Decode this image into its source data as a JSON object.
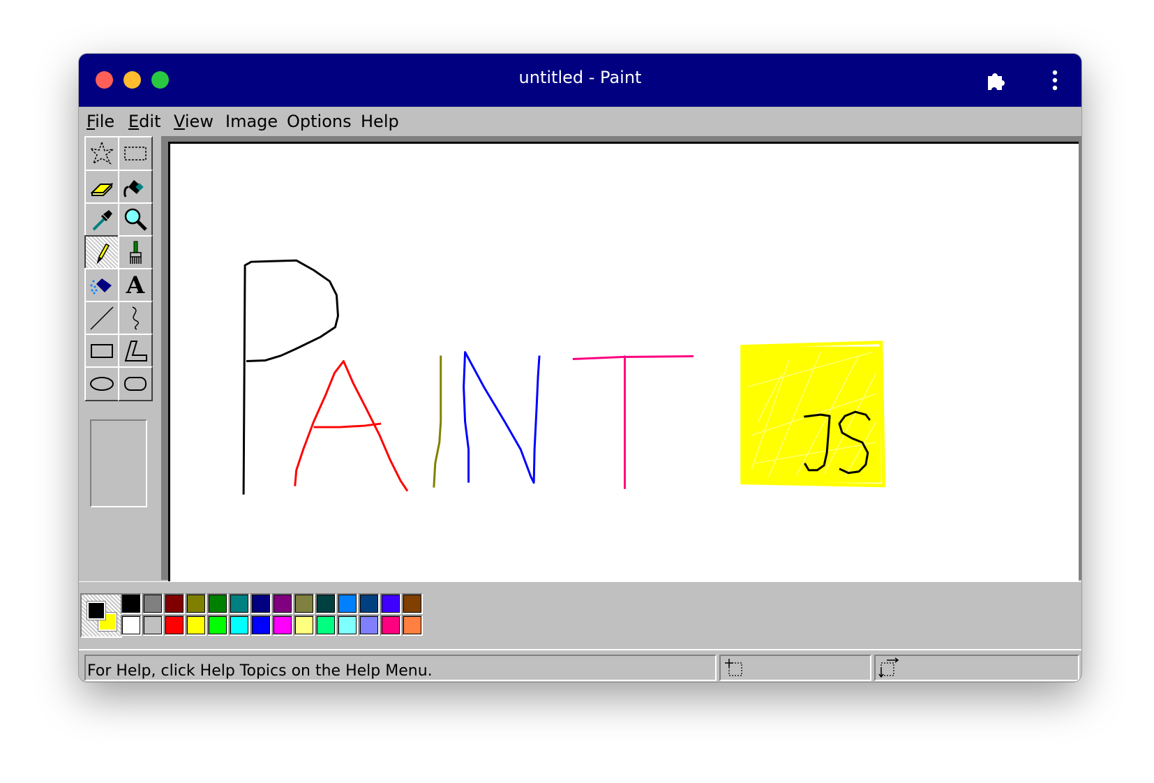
{
  "window": {
    "title": "untitled - Paint",
    "extensions_icon": "puzzle-piece-icon",
    "more_icon": "kebab-menu-icon"
  },
  "menu": [
    {
      "label_u": "F",
      "label_rest": "ile"
    },
    {
      "label_u": "E",
      "label_rest": "dit"
    },
    {
      "label_u": "V",
      "label_rest": "iew"
    },
    {
      "label": "Image"
    },
    {
      "label": "Options"
    },
    {
      "label": "Help"
    }
  ],
  "tools": [
    {
      "name": "free-form-select",
      "icon": "free-form-select-icon"
    },
    {
      "name": "rect-select",
      "icon": "rect-select-icon"
    },
    {
      "name": "eraser",
      "icon": "eraser-icon"
    },
    {
      "name": "fill",
      "icon": "fill-bucket-icon"
    },
    {
      "name": "pick-color",
      "icon": "eyedropper-icon"
    },
    {
      "name": "magnifier",
      "icon": "magnifier-icon"
    },
    {
      "name": "pencil",
      "icon": "pencil-icon",
      "selected": true
    },
    {
      "name": "brush",
      "icon": "brush-icon"
    },
    {
      "name": "airbrush",
      "icon": "airbrush-icon"
    },
    {
      "name": "text",
      "icon": "text-icon",
      "glyph": "A"
    },
    {
      "name": "line",
      "icon": "line-icon"
    },
    {
      "name": "curve",
      "icon": "curve-icon"
    },
    {
      "name": "rectangle",
      "icon": "rectangle-icon"
    },
    {
      "name": "polygon",
      "icon": "polygon-icon"
    },
    {
      "name": "ellipse",
      "icon": "ellipse-icon"
    },
    {
      "name": "rounded-rectangle",
      "icon": "rounded-rectangle-icon"
    }
  ],
  "colors": {
    "foreground": "#000000",
    "background": "#ffff00",
    "palette_top": [
      "#000000",
      "#808080",
      "#800000",
      "#808000",
      "#008000",
      "#008080",
      "#000080",
      "#800080",
      "#808040",
      "#004040",
      "#0080ff",
      "#004080",
      "#4000ff",
      "#804000"
    ],
    "palette_bottom": [
      "#ffffff",
      "#c0c0c0",
      "#ff0000",
      "#ffff00",
      "#00ff00",
      "#00ffff",
      "#0000ff",
      "#ff00ff",
      "#ffff80",
      "#00ff80",
      "#80ffff",
      "#8080ff",
      "#ff0080",
      "#ff8040"
    ]
  },
  "status": {
    "help_text": "For Help, click Help Topics on the Help Menu.",
    "position_icon": "cursor-position-icon",
    "size_icon": "selection-size-icon"
  }
}
